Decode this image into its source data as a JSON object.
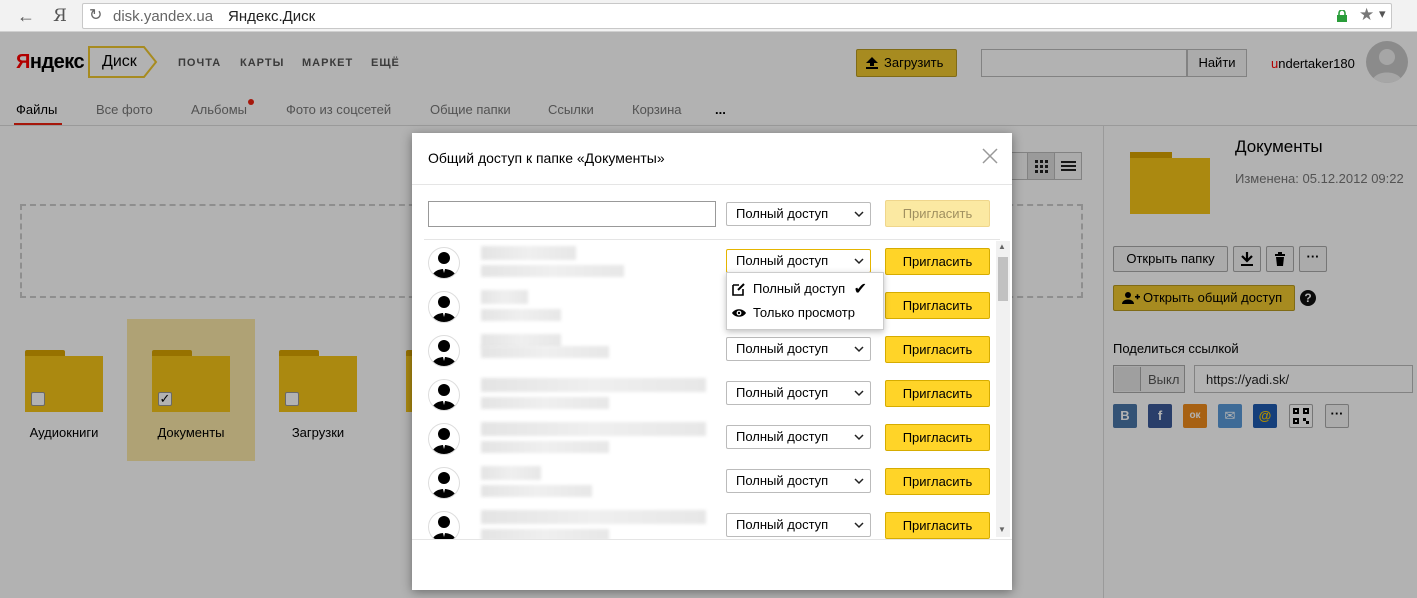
{
  "browser": {
    "domain": "disk.yandex.ua",
    "page_title": "Яндекс.Диск"
  },
  "header": {
    "logo_y": "Я",
    "logo_rest": "ндекс",
    "product": "Диск",
    "nav": [
      "ПОЧТА",
      "КАРТЫ",
      "МАРКЕТ",
      "ЕЩЁ"
    ],
    "upload_label": "Загрузить",
    "search_value": "",
    "search_button": "Найти",
    "username_first": "u",
    "username_rest": "ndertaker180"
  },
  "tabs": [
    "Файлы",
    "Все фото",
    "Альбомы",
    "Фото из соцсетей",
    "Общие папки",
    "Ссылки",
    "Корзина",
    "..."
  ],
  "folders": [
    {
      "name": "Аудиокниги",
      "checked": false
    },
    {
      "name": "Документы",
      "checked": true
    },
    {
      "name": "Загрузки",
      "checked": false
    }
  ],
  "panel": {
    "title": "Документы",
    "modified": "Изменена: 05.12.2012 09:22",
    "open_folder": "Открыть папку",
    "more": "···",
    "open_share": "Открыть общий доступ",
    "help": "?",
    "share_link_label": "Поделиться ссылкой",
    "toggle_label": "Выкл",
    "link_value": "https://yadi.sk/",
    "social": [
      "В",
      "f",
      "ок",
      "✉",
      "@",
      "qr",
      "···"
    ]
  },
  "modal": {
    "title": "Общий доступ к папке «Документы»",
    "invite_value": "",
    "access_options": [
      "Полный доступ",
      "Только просмотр"
    ],
    "selected_access": "Полный доступ",
    "invite_button": "Пригласить",
    "rows_count": 7
  },
  "colors": {
    "accent_yellow": "#ffd428",
    "folder_yellow": "#f5c517",
    "brand_red": "#ff0000"
  }
}
